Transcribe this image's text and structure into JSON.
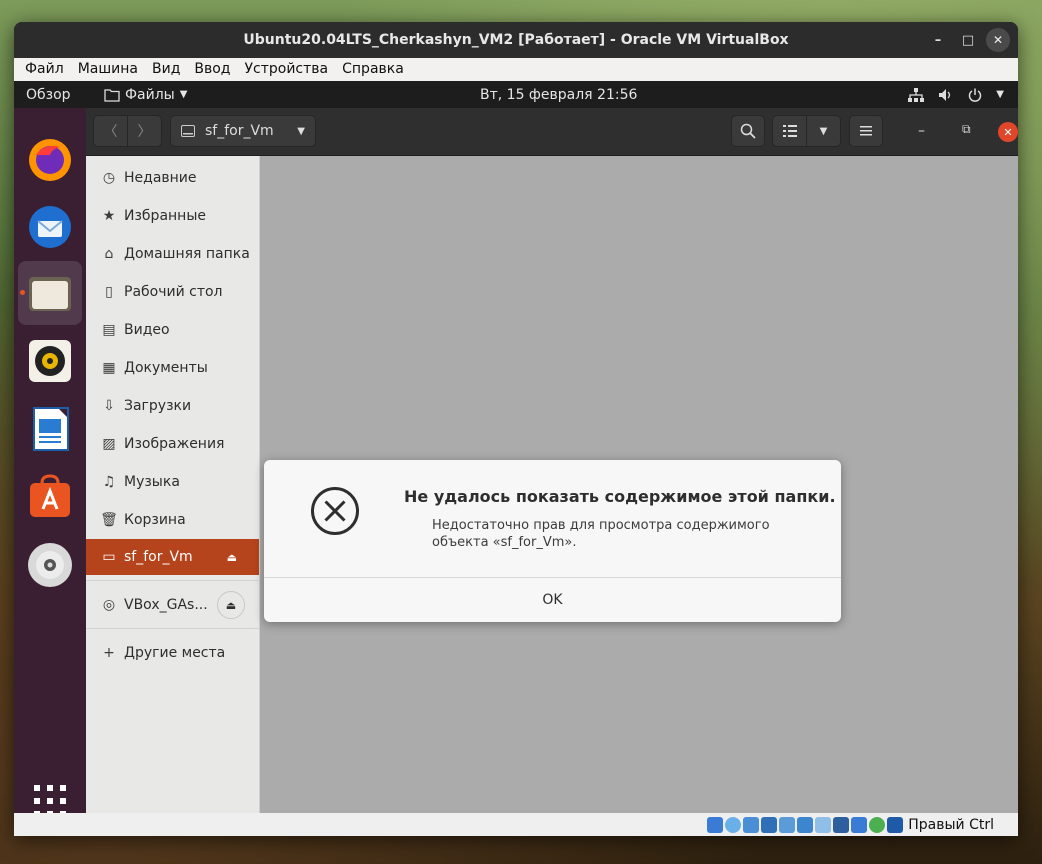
{
  "window": {
    "title": "Ubuntu20.04LTS_Cherkashyn_VM2 [Работает] - Oracle VM VirtualBox",
    "controls": {
      "minimize": "–",
      "maximize": "□",
      "close": "✕"
    }
  },
  "vbox_menu": [
    "Файл",
    "Машина",
    "Вид",
    "Ввод",
    "Устройства",
    "Справка"
  ],
  "topbar": {
    "overview": "Обзор",
    "app_menu": "Файлы",
    "clock": "Вт, 15 февраля  21:56"
  },
  "headerbar": {
    "path": "sf_for_Vm"
  },
  "sidebar": {
    "items": [
      {
        "label": "Недавние",
        "icon": "clock-icon"
      },
      {
        "label": "Избранные",
        "icon": "star-icon"
      },
      {
        "label": "Домашняя папка",
        "icon": "home-icon"
      },
      {
        "label": "Рабочий стол",
        "icon": "desktop-icon"
      },
      {
        "label": "Видео",
        "icon": "video-icon"
      },
      {
        "label": "Документы",
        "icon": "document-icon"
      },
      {
        "label": "Загрузки",
        "icon": "download-icon"
      },
      {
        "label": "Изображения",
        "icon": "image-icon"
      },
      {
        "label": "Музыка",
        "icon": "music-icon"
      },
      {
        "label": "Корзина",
        "icon": "trash-icon"
      }
    ],
    "mounted": {
      "label": "sf_for_Vm",
      "selected": true
    },
    "device": {
      "label": "VBox_GAs..."
    },
    "other": {
      "label": "Другие места"
    }
  },
  "dialog": {
    "title": "Не удалось показать содержимое этой папки.",
    "message": "Недостаточно прав для просмотра содержимого объекта «sf_for_Vm».",
    "ok": "OK"
  },
  "statusbar": {
    "host_key": "Правый Ctrl"
  },
  "colors": {
    "accent": "#e95420",
    "selection": "#b5431c",
    "dock": "#3a1f33"
  }
}
